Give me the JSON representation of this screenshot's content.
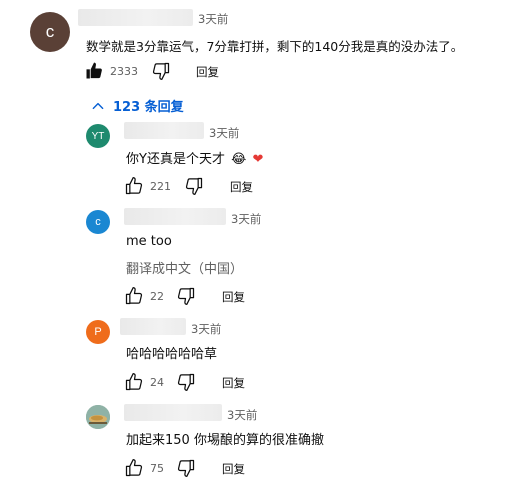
{
  "colors": {
    "link_blue": "#065fd4",
    "secondary_text": "#606060",
    "avatar_main": "#5a4036",
    "avatar_yt": "#1e8a6e",
    "avatar_c": "#1a87d2",
    "avatar_p": "#ef6c1b",
    "heart": "#e53935"
  },
  "main_comment": {
    "avatar_letter": "c",
    "time": "3天前",
    "text": "数学就是3分靠运气，7分靠打拼，剩下的140分我是真的没办法了。",
    "like_count": "2333",
    "reply_label": "回复",
    "liked": true
  },
  "replies_toggle": {
    "icon": "chevron-up-icon",
    "label": "123 条回复"
  },
  "replies": [
    {
      "avatar_letter": "YT",
      "time": "3天前",
      "text": "你Y还真是个天才",
      "emoji_grin": "😂",
      "emoji_heart": "❤",
      "like_count": "221",
      "reply_label": "回复"
    },
    {
      "avatar_letter": "c",
      "time": "3天前",
      "text": "me too",
      "translate_label": "翻译成中文（中国）",
      "like_count": "22",
      "reply_label": "回复"
    },
    {
      "avatar_letter": "P",
      "time": "3天前",
      "text": "哈哈哈哈哈哈草",
      "like_count": "24",
      "reply_label": "回复"
    },
    {
      "avatar_letter": "",
      "time": "3天前",
      "text": "加起来150 你埸酿的算的很准确撤",
      "like_count": "75",
      "reply_label": "回复"
    }
  ]
}
